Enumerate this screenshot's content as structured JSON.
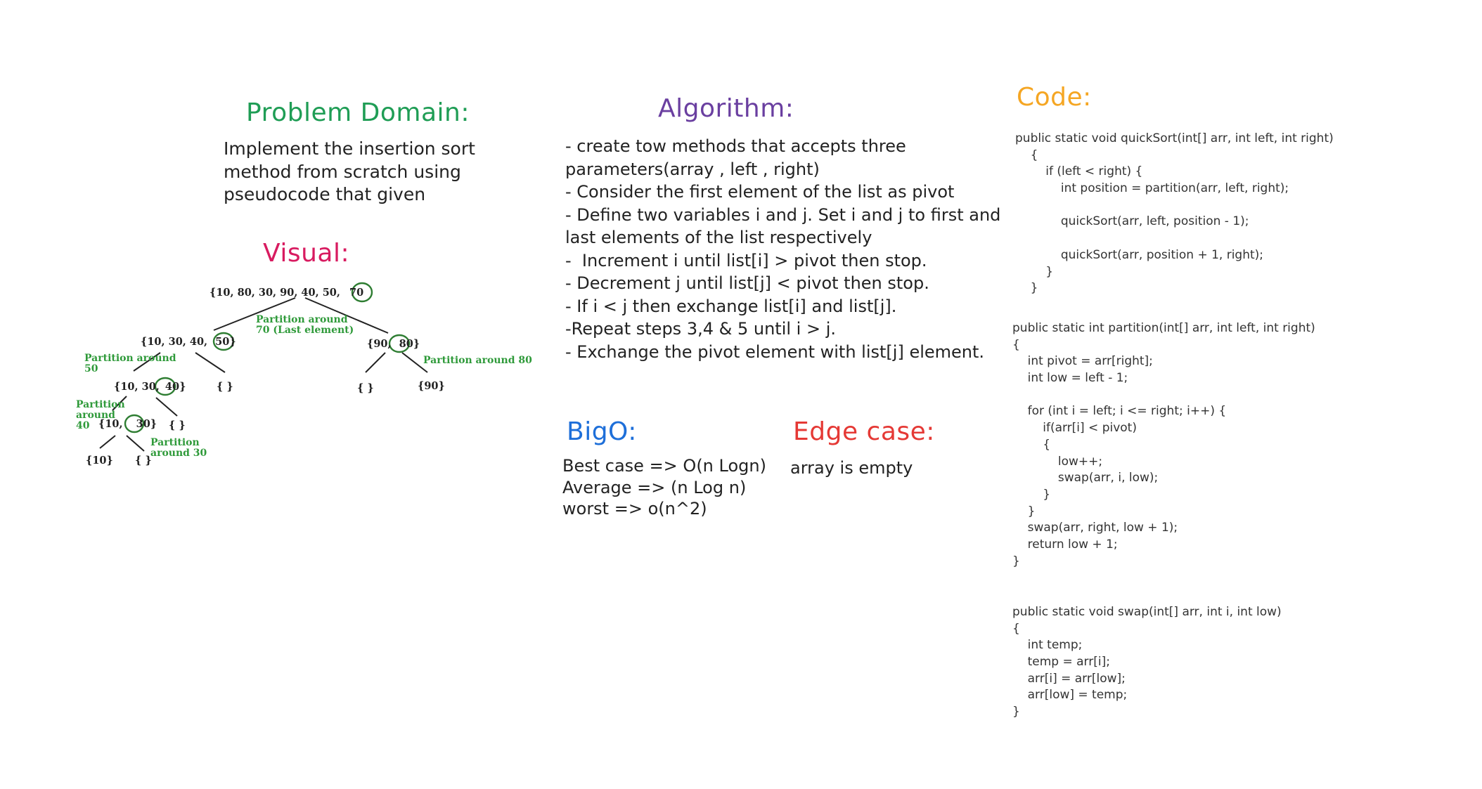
{
  "colors": {
    "problem_heading": "#1f9d55",
    "visual_heading": "#d81b60",
    "algorithm_heading": "#6a3fa0",
    "code_heading": "#f5a623",
    "bigo_heading": "#1e6fd9",
    "edge_heading": "#e53935",
    "annotation": "#2f9a3a",
    "pivot_circle": "#2e7d32"
  },
  "problem_domain": {
    "heading": "Problem Domain:",
    "lines": [
      "Implement the insertion sort",
      "method from scratch using",
      "pseudocode that given"
    ]
  },
  "visual": {
    "heading": "Visual:",
    "nodes": [
      {
        "text": "{10,  80,  30,  90,  40,  50,",
        "pivot": "70"
      },
      {
        "text": "{10,  30,  40,",
        "pivot": "50}"
      },
      {
        "text": "{90,",
        "pivot": "80}"
      },
      {
        "text": "{10, 30,",
        "pivot": "40}"
      },
      {
        "text": "{ }",
        "pivot": ""
      },
      {
        "text": "{ }",
        "pivot": ""
      },
      {
        "text": "{90}",
        "pivot": ""
      },
      {
        "text": "{10,",
        "pivot": "30}"
      },
      {
        "text": "{ }",
        "pivot": ""
      },
      {
        "text": "{10}",
        "pivot": ""
      },
      {
        "text": "{  }",
        "pivot": ""
      }
    ],
    "annotations": [
      {
        "lines": [
          "Partition around",
          "70 (Last element)"
        ]
      },
      {
        "lines": [
          "Partition around",
          "50"
        ]
      },
      {
        "lines": [
          "Partition around 80"
        ]
      },
      {
        "lines": [
          "Partition",
          "around",
          "40"
        ]
      },
      {
        "lines": [
          "Partition",
          "around  30"
        ]
      }
    ]
  },
  "algorithm": {
    "heading": "Algorithm:",
    "lines": [
      "- create tow methods that accepts three",
      "parameters(array , left , right)",
      "- Consider the first element of the list as pivot",
      "- Define two variables i and j. Set i and j to first and",
      "last elements of the list respectively",
      "-  Increment i until list[i] > pivot then stop.",
      "- Decrement j until list[j] < pivot then stop.",
      "- If i < j then exchange list[i] and list[j].",
      "-Repeat steps 3,4 & 5 until i > j.",
      "- Exchange the pivot element with list[j] element."
    ]
  },
  "bigo": {
    "heading": "BigO:",
    "lines": [
      "Best case => O(n Logn)",
      "Average => (n Log n)",
      "worst => o(n^2)"
    ]
  },
  "edge_case": {
    "heading": "Edge case:",
    "lines": [
      "array is empty"
    ]
  },
  "code": {
    "heading": "Code:",
    "blocks": [
      [
        "public static void quickSort(int[] arr, int left, int right)",
        "    {",
        "        if (left < right) {",
        "            int position = partition(arr, left, right);",
        "",
        "            quickSort(arr, left, position - 1);",
        "",
        "            quickSort(arr, position + 1, right);",
        "        }",
        "    }"
      ],
      [
        "public static int partition(int[] arr, int left, int right)",
        "{",
        "    int pivot = arr[right];",
        "    int low = left - 1;",
        "",
        "    for (int i = left; i <= right; i++) {",
        "        if(arr[i] < pivot)",
        "        {",
        "            low++;",
        "            swap(arr, i, low);",
        "        }",
        "    }",
        "    swap(arr, right, low + 1);",
        "    return low + 1;",
        "}"
      ],
      [
        "public static void swap(int[] arr, int i, int low)",
        "{",
        "    int temp;",
        "    temp = arr[i];",
        "    arr[i] = arr[low];",
        "    arr[low] = temp;",
        "}"
      ]
    ]
  }
}
